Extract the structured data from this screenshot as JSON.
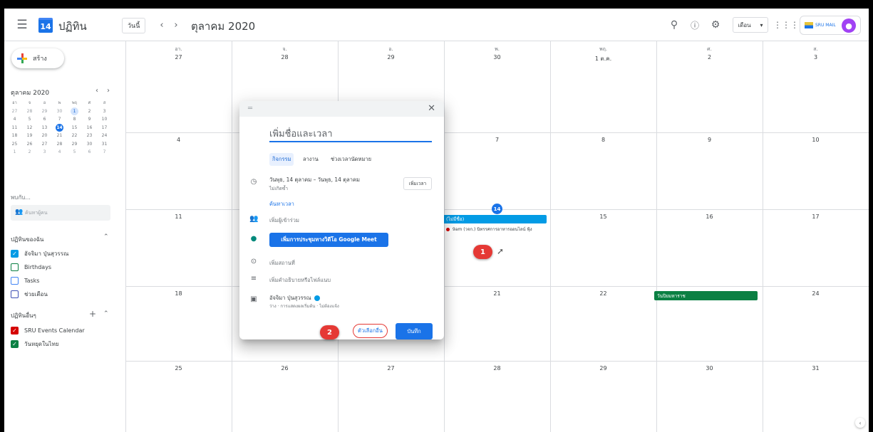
{
  "header": {
    "logo_day": "14",
    "app_title": "ปฏิทิน",
    "today_label": "วันนี้",
    "month_title": "ตุลาคม 2020",
    "view_label": "เดือน"
  },
  "account": {
    "logo_text": "SRU MAIL",
    "avatar_letter": ""
  },
  "sidebar": {
    "create_label": "สร้าง",
    "mini_title": "ตุลาคม 2020",
    "mini_dows": [
      "อา",
      "จ",
      "อ",
      "พ",
      "พฤ",
      "ศ",
      "ส"
    ],
    "mini_weeks": [
      [
        "27",
        "28",
        "29",
        "30",
        "1",
        "2",
        "3"
      ],
      [
        "4",
        "5",
        "6",
        "7",
        "8",
        "9",
        "10"
      ],
      [
        "11",
        "12",
        "13",
        "14",
        "15",
        "16",
        "17"
      ],
      [
        "18",
        "19",
        "20",
        "21",
        "22",
        "23",
        "24"
      ],
      [
        "25",
        "26",
        "27",
        "28",
        "29",
        "30",
        "31"
      ],
      [
        "1",
        "2",
        "3",
        "4",
        "5",
        "6",
        "7"
      ]
    ],
    "search_people_label": "พบกับ...",
    "search_people_placeholder": "ค้นหาผู้คน",
    "my_calendars_title": "ปฏิทินของฉัน",
    "my_calendars": [
      {
        "label": "อัจจิมา ปุ่นสุวรรณ",
        "checked": true,
        "color": "#039be5"
      },
      {
        "label": "Birthdays",
        "checked": false,
        "color": "#0b8043"
      },
      {
        "label": "Tasks",
        "checked": false,
        "color": "#4285f4"
      },
      {
        "label": "ช่วยเตือน",
        "checked": false,
        "color": "#3f51b5"
      }
    ],
    "other_calendars_title": "ปฏิทินอื่นๆ",
    "other_calendars": [
      {
        "label": "SRU Events Calendar",
        "checked": true,
        "color": "#d50000"
      },
      {
        "label": "วันหยุดในไทย",
        "checked": true,
        "color": "#0b8043"
      }
    ]
  },
  "grid": {
    "day_labels": [
      "อา.",
      "จ.",
      "อ.",
      "พ.",
      "พฤ.",
      "ศ.",
      "ส."
    ],
    "weeks": [
      [
        "27",
        "28",
        "29",
        "30",
        "1 ต.ค.",
        "2",
        "3"
      ],
      [
        "4",
        "5",
        "6",
        "7",
        "8",
        "9",
        "10"
      ],
      [
        "11",
        "12",
        "13",
        "14",
        "15",
        "16",
        "17"
      ],
      [
        "18",
        "19",
        "20",
        "21",
        "22",
        "23",
        "24"
      ],
      [
        "25",
        "26",
        "27",
        "28",
        "29",
        "30",
        "31"
      ]
    ],
    "new_event_chip": "(ไม่มีชื่อ)",
    "event_line": "9am (วจก.) นิทรรศการอาหารออนไลน์ ฟุ้ง",
    "holiday_chip": "วันปิยมหาราช"
  },
  "markers": {
    "one": "1",
    "two": "2"
  },
  "dialog": {
    "title_placeholder": "เพิ่มชื่อและเวลา",
    "tabs": [
      "กิจกรรม",
      "ลางาน",
      "ช่วงเวลานัดหมาย"
    ],
    "date_range": "วันพุธ, 14 ตุลาคม  –  วันพุธ, 14 ตุลาคม",
    "repeat": "ไม่เกิดซ้ำ",
    "add_time": "เพิ่มเวลา",
    "find_time": "ค้นหาเวลา",
    "add_guests": "เพิ่มผู้เข้าร่วม",
    "meet_button": "เพิ่มการประชุมทางวิดีโอ Google Meet",
    "add_location": "เพิ่มสถานที่",
    "add_description": "เพิ่มคำอธิบายหรือไฟล์แนบ",
    "owner_name": "อัจจิมา ปุ่นสุวรรณ",
    "owner_status": "ว่าง · การแสดงผลเริ่มต้น · ไม่ต้องแจ้ง",
    "more_options": "ตัวเลือกอื่น",
    "save": "บันทึก"
  }
}
